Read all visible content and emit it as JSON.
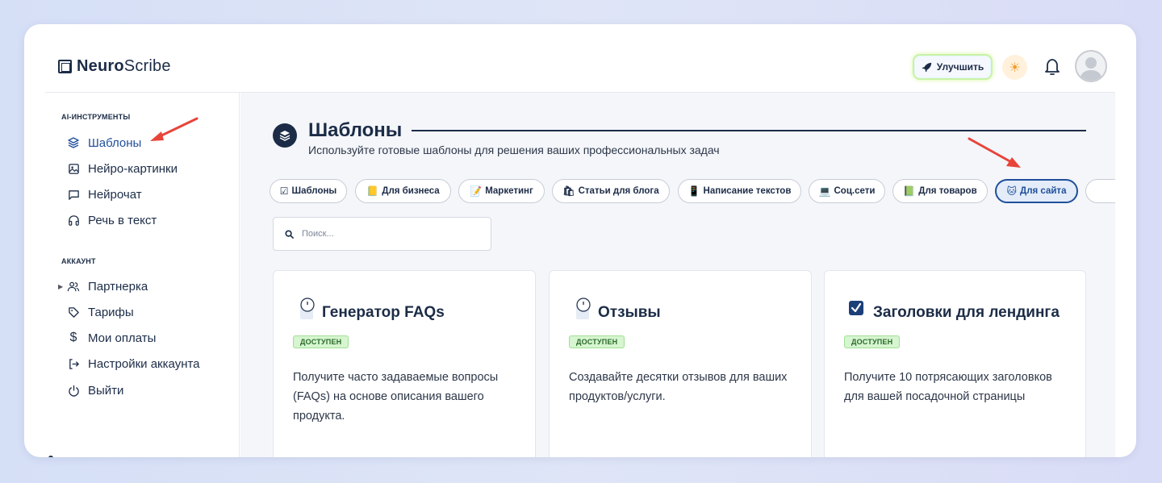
{
  "app": {
    "brand_bold": "Neuro",
    "brand_rest": "Scribe"
  },
  "header": {
    "upgrade_label": "Улучшить"
  },
  "sidebar": {
    "section_tools": "AI-ИНСТРУМЕНТЫ",
    "tools": [
      {
        "label": "Шаблоны",
        "icon": "layers-icon"
      },
      {
        "label": "Нейро-картинки",
        "icon": "image-icon"
      },
      {
        "label": "Нейрочат",
        "icon": "chat-icon"
      },
      {
        "label": "Речь в текст",
        "icon": "headphones-icon"
      }
    ],
    "section_account": "АККАУНТ",
    "account": [
      {
        "label": "Партнерка",
        "icon": "users-icon"
      },
      {
        "label": "Тарифы",
        "icon": "tag-icon"
      },
      {
        "label": "Мои оплаты",
        "icon": "dollar-icon"
      },
      {
        "label": "Настройки аккаунта",
        "icon": "login-icon"
      },
      {
        "label": "Выйти",
        "icon": "power-icon"
      }
    ]
  },
  "main": {
    "title": "Шаблоны",
    "subtitle": "Используйте готовые шаблоны для решения ваших профессиональных задач",
    "search_placeholder": "Поиск...",
    "tabs": [
      {
        "emoji": "☑",
        "label": "Шаблоны"
      },
      {
        "emoji": "📒",
        "label": "Для бизнеса"
      },
      {
        "emoji": "📝",
        "label": "Маркетинг"
      },
      {
        "emoji": "🛍",
        "label": "Статьи для блога"
      },
      {
        "emoji": "📱",
        "label": "Написание текстов"
      },
      {
        "emoji": "💻",
        "label": "Соц.сети"
      },
      {
        "emoji": "📗",
        "label": "Для товаров"
      },
      {
        "emoji": "🐱",
        "label": "Для сайта"
      }
    ],
    "active_tab": "Для сайта",
    "cards": [
      {
        "title": "Генератор FAQs",
        "badge": "ДОСТУПЕН",
        "description": "Получите часто задаваемые вопросы (FAQs) на основе описания вашего продукта.",
        "icon": "clock-icon"
      },
      {
        "title": "Отзывы",
        "badge": "ДОСТУПЕН",
        "description": "Создавайте десятки отзывов для ваших продуктов/услуги.",
        "icon": "clock-icon"
      },
      {
        "title": "Заголовки для лендинга",
        "badge": "ДОСТУПЕН",
        "description": "Получите 10 потрясающих заголовков для вашей посадочной страницы",
        "icon": "checkbox-icon"
      }
    ]
  },
  "colors": {
    "brand": "#1c2c47",
    "accent": "#1f4f9b",
    "badge_bg": "#d6f5d0",
    "arrow": "#e8443a"
  }
}
